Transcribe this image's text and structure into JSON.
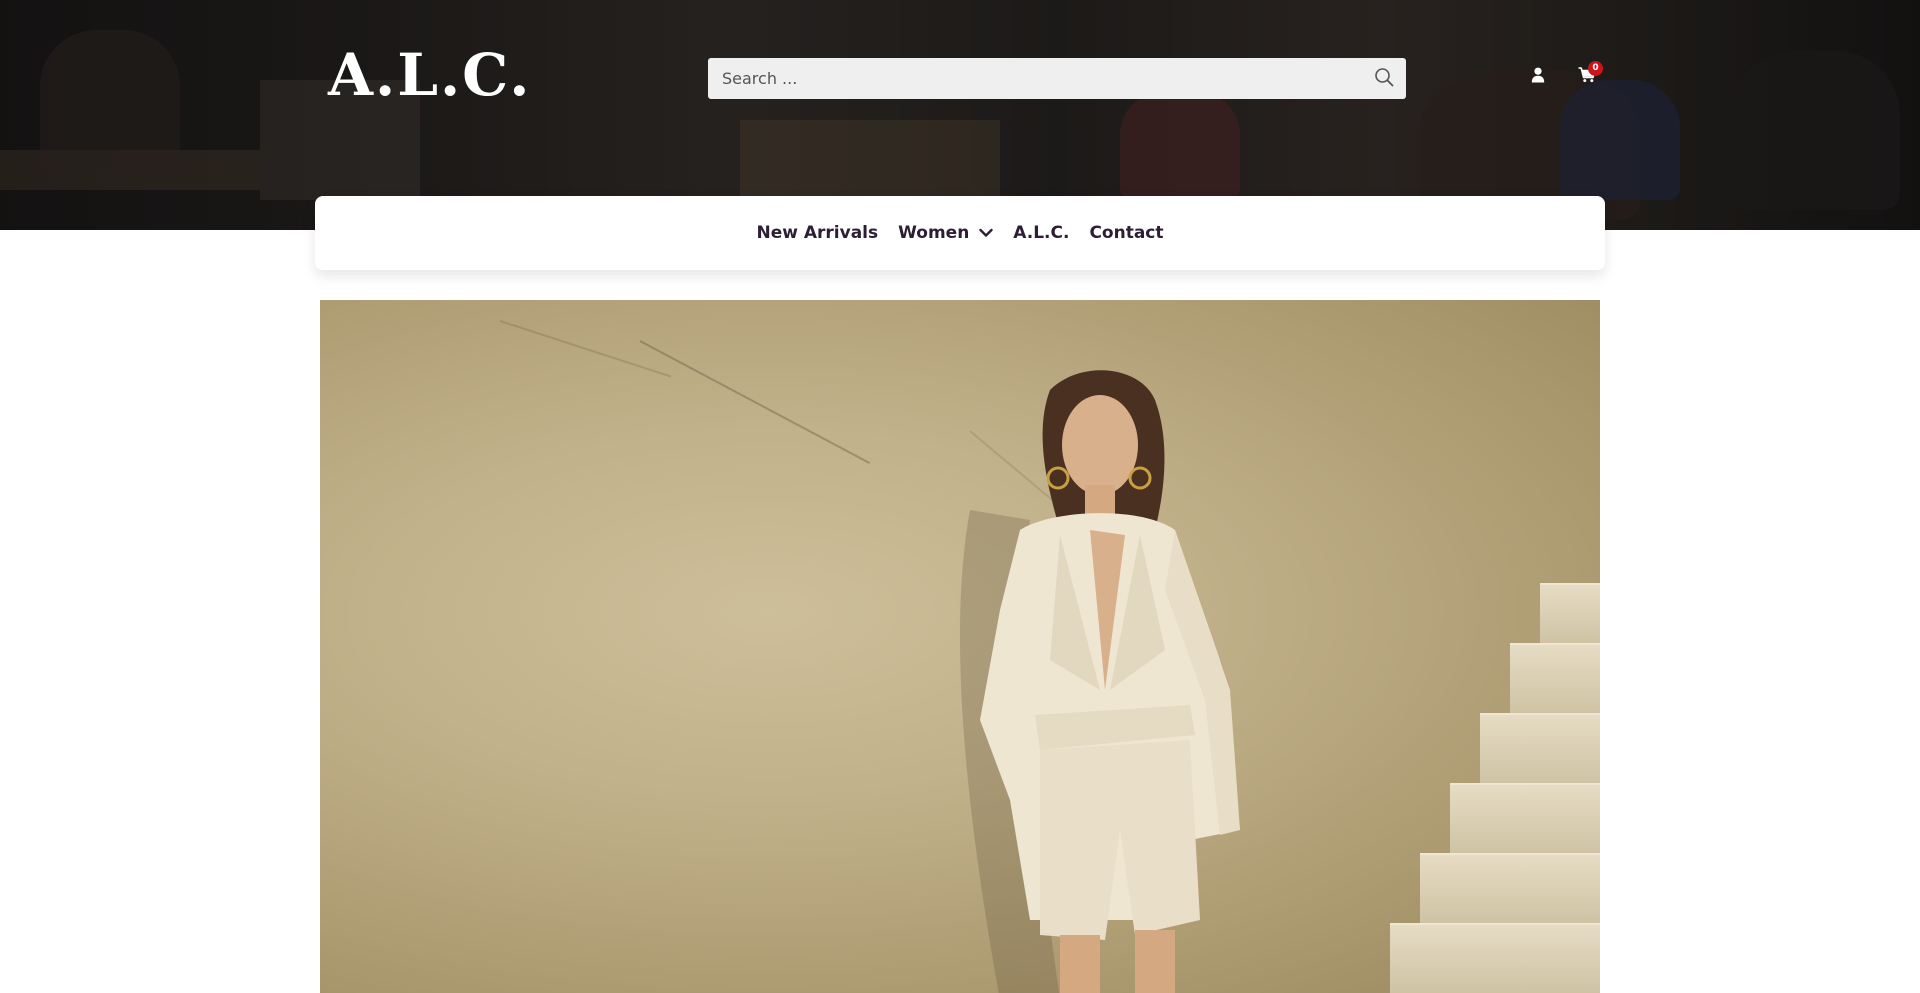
{
  "header": {
    "logo_text": "A.L.C.",
    "search": {
      "placeholder": "Search ...",
      "value": ""
    },
    "cart": {
      "count": "0"
    },
    "icons": {
      "search": "search-icon",
      "account": "user-icon",
      "cart": "cart-icon"
    }
  },
  "nav": {
    "items": [
      {
        "label": "New Arrivals"
      },
      {
        "label": "Women",
        "has_dropdown": true
      },
      {
        "label": "A.L.C."
      },
      {
        "label": "Contact"
      }
    ]
  },
  "colors": {
    "nav_text": "#2d1d35",
    "cart_badge": "#d0131b",
    "search_bg": "#efefef"
  }
}
